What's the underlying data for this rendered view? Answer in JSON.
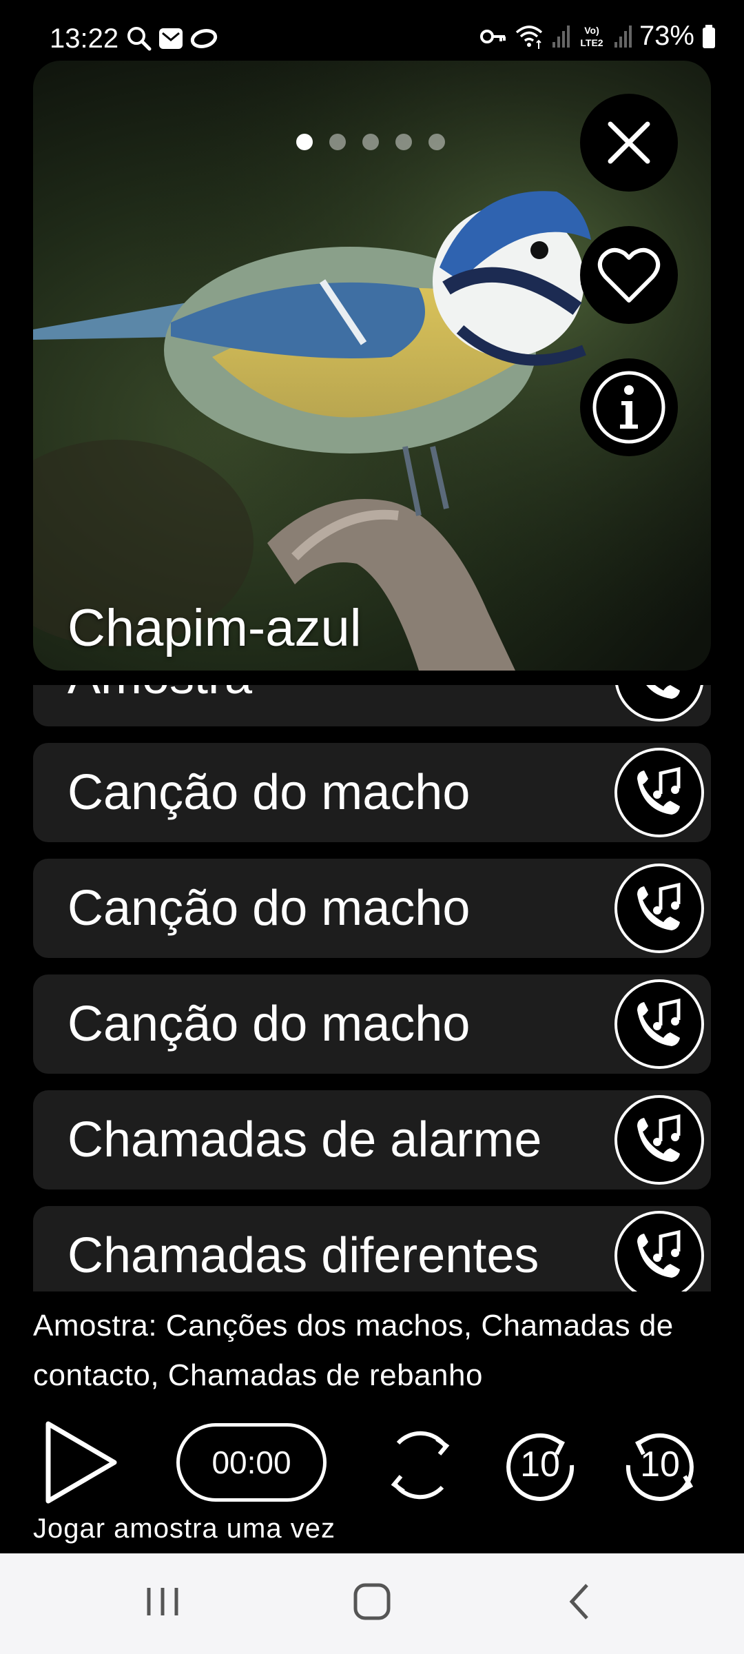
{
  "status_bar": {
    "time": "13:22",
    "battery": "73%",
    "left_icons": [
      "search-icon",
      "mail-icon",
      "ring-icon"
    ],
    "right_icons": [
      "vpn-key-icon",
      "wifi-icon",
      "signal-icon",
      "volte-icon",
      "signal-icon",
      "battery-icon"
    ],
    "volte_text": "Vo) LTE2"
  },
  "hero": {
    "bird_name": "Chapim-azul",
    "pager": {
      "count": 5,
      "active_index": 0
    },
    "buttons": [
      "close-icon",
      "heart-icon",
      "info-icon"
    ]
  },
  "recordings": [
    {
      "label": "Amostra"
    },
    {
      "label": "Canção do macho"
    },
    {
      "label": "Canção do macho"
    },
    {
      "label": "Canção do macho"
    },
    {
      "label": "Chamadas de alarme"
    },
    {
      "label": "Chamadas diferentes"
    }
  ],
  "description": "Amostra: Canções dos machos, Chamadas de contacto, Chamadas de rebanho",
  "player": {
    "time": "00:00",
    "forward_seconds": "10",
    "back_seconds": "10",
    "mode_label": "Jogar amostra uma vez"
  },
  "nav_bar": [
    "recents-icon",
    "home-icon",
    "back-icon"
  ],
  "colors": {
    "background": "#000000",
    "row": "#1d1d1d",
    "nav": "#f5f5f7"
  }
}
